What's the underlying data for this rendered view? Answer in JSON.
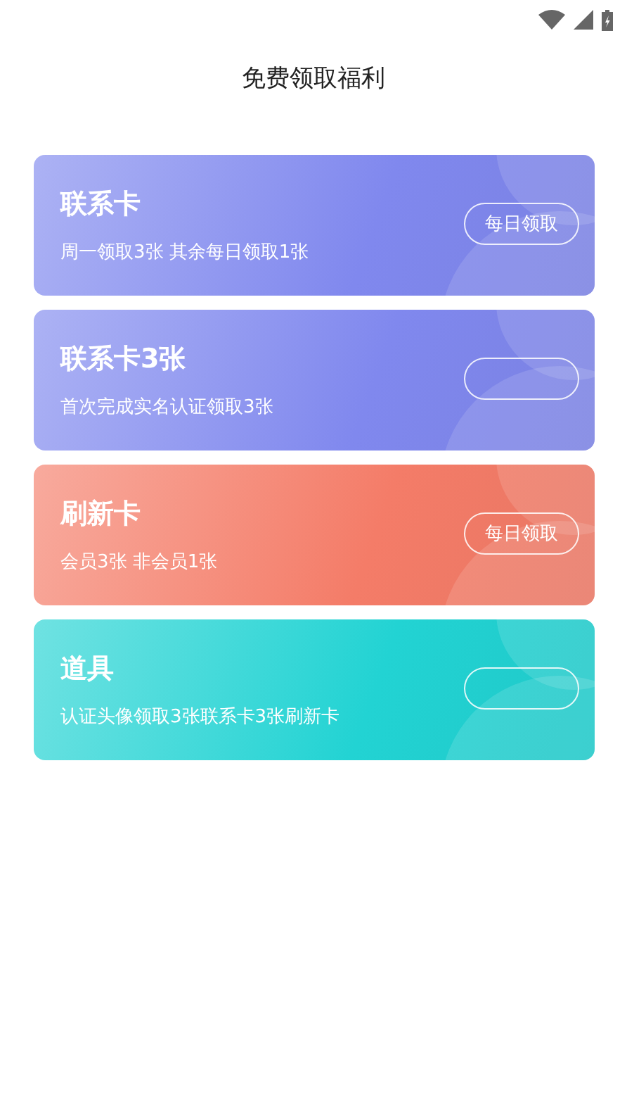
{
  "header": {
    "title": "免费领取福利"
  },
  "cards": [
    {
      "title": "联系卡",
      "description": "周一领取3张 其余每日领取1张",
      "button": "每日领取",
      "color": "#8088ee"
    },
    {
      "title": "联系卡3张",
      "description": "首次完成实名认证领取3张",
      "color": "#8088ee"
    },
    {
      "title": "刷新卡",
      "description": "会员3张 非会员1张",
      "button": "每日领取",
      "color": "#f47c68"
    },
    {
      "title": "道具",
      "description": "认证头像领取3张联系卡3张刷新卡",
      "color": "#22d3d3"
    }
  ]
}
